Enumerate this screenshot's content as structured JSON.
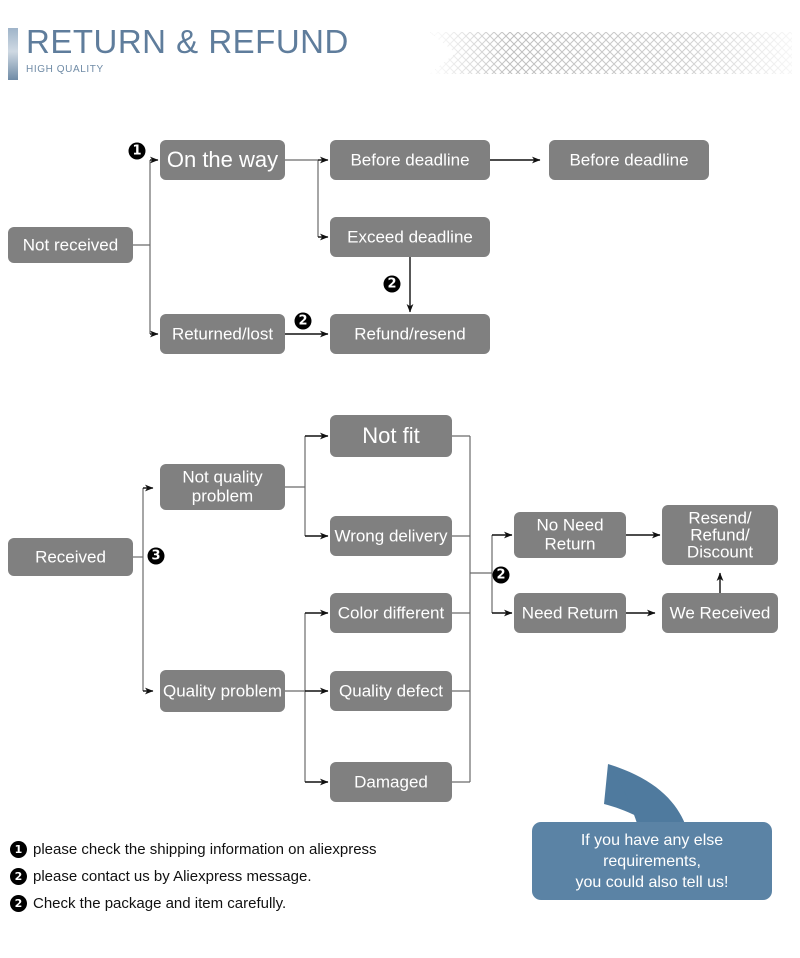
{
  "header": {
    "title": "RETURN & REFUND",
    "subtitle": "HIGH QUALITY",
    "accent_color": "#5f7d9c",
    "ribbon_color": "#b8b8b8"
  },
  "theme": {
    "box_fill": "#808080",
    "box_text": "#ffffff",
    "connector": "#6b6b6b",
    "badge_fill": "#000000",
    "bubble_fill": "#5b83a5"
  },
  "flowchart": {
    "type": "diagram",
    "section_not_received": {
      "root": "Not received",
      "nodes": [
        "On the way",
        "Before deadline",
        "Before deadline",
        "Exceed deadline",
        "Returned/lost",
        "Refund/resend"
      ],
      "badges": [
        "1",
        "2",
        "2"
      ]
    },
    "section_received": {
      "root": "Received",
      "branch_nodes": [
        "Not quality problem",
        "Quality problem"
      ],
      "reason_nodes": [
        "Not fit",
        "Wrong delivery",
        "Color different",
        "Quality defect",
        "Damaged"
      ],
      "return_nodes": [
        "No Need Return",
        "Need Return"
      ],
      "outcome_nodes": [
        "Resend/ Refund/ Discount",
        "We Received"
      ],
      "outcome_lines": [
        "Resend/",
        "Refund/",
        "Discount"
      ],
      "badges": [
        "3",
        "2"
      ]
    }
  },
  "boxes": {
    "not_received": "Not received",
    "on_the_way": "On the way",
    "before_deadline_1": "Before deadline",
    "before_deadline_2": "Before deadline",
    "exceed_deadline": "Exceed deadline",
    "returned_lost": "Returned/lost",
    "refund_resend": "Refund/resend",
    "received": "Received",
    "not_quality_problem_l1": "Not quality",
    "not_quality_problem_l2": "problem",
    "quality_problem": "Quality problem",
    "not_fit": "Not fit",
    "wrong_delivery": "Wrong delivery",
    "color_different": "Color different",
    "quality_defect": "Quality defect",
    "damaged": "Damaged",
    "no_need_return_l1": "No Need",
    "no_need_return_l2": "Return",
    "need_return": "Need Return",
    "we_received": "We Received",
    "resend_l1": "Resend/",
    "resend_l2": "Refund/",
    "resend_l3": "Discount"
  },
  "badges": {
    "b1": "1",
    "b2": "2",
    "b3": "3"
  },
  "notes": [
    {
      "badge": "1",
      "text": "please check the shipping information on aliexpress"
    },
    {
      "badge": "2",
      "text": "please contact us by Aliexpress message."
    },
    {
      "badge": "2",
      "text": "Check the package and item carefully."
    }
  ],
  "bubble": {
    "line1": "If you have any else",
    "line2": "requirements,",
    "line3": "you could also tell us!"
  }
}
